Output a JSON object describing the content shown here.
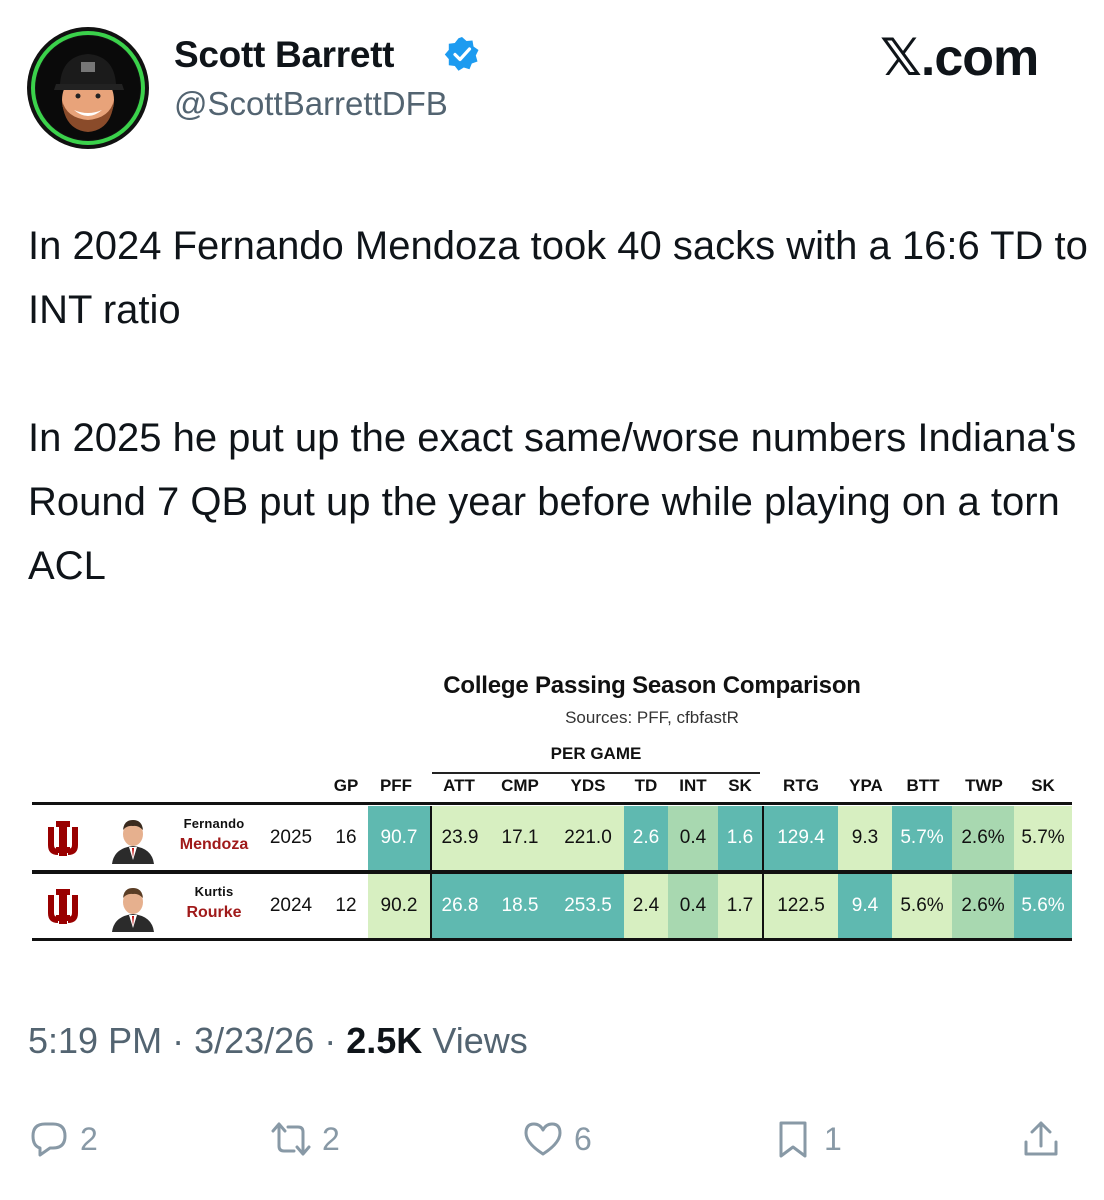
{
  "author": {
    "name": "Scott Barrett",
    "handle": "@ScottBarrettDFB",
    "verified": true,
    "avatar_icon": "avatar-cartoon-man-cap"
  },
  "brand": "𝕏.com",
  "tweet": {
    "paragraph1": "In 2024 Fernando Mendoza took 40 sacks with a 16:6 TD to INT ratio",
    "paragraph2": "In 2025 he put up the exact same/worse numbers Indiana's Round 7 QB put up the year before while playing on a torn ACL"
  },
  "table": {
    "title": "College Passing Season Comparison",
    "sources": "Sources: PFF, cfbfastR",
    "group_label": "PER GAME",
    "headers": [
      "GP",
      "PFF",
      "ATT",
      "CMP",
      "YDS",
      "TD",
      "INT",
      "SK",
      "RTG",
      "YPA",
      "BTT",
      "TWP",
      "SK"
    ],
    "rows": [
      {
        "first": "Fernando",
        "last": "Mendoza",
        "season": "2025",
        "values": [
          "16",
          "90.7",
          "23.9",
          "17.1",
          "221.0",
          "2.6",
          "0.4",
          "1.6",
          "129.4",
          "9.3",
          "5.7%",
          "2.6%",
          "5.7%"
        ]
      },
      {
        "first": "Kurtis",
        "last": "Rourke",
        "season": "2024",
        "values": [
          "12",
          "90.2",
          "26.8",
          "18.5",
          "253.5",
          "2.4",
          "0.4",
          "1.7",
          "122.5",
          "9.4",
          "5.6%",
          "2.6%",
          "5.6%"
        ]
      }
    ],
    "colors": {
      "light_green": "#d7efc1",
      "mid_green": "#a8d8b0",
      "teal": "#5fb9b0",
      "logo_red": "#990000"
    }
  },
  "timestamp": {
    "time": "5:19 PM",
    "date": "3/23/26",
    "views_count": "2.5K",
    "views_label": "Views",
    "separator": "·"
  },
  "actions": {
    "replies": "2",
    "reposts": "2",
    "likes": "6",
    "bookmarks": "1"
  }
}
